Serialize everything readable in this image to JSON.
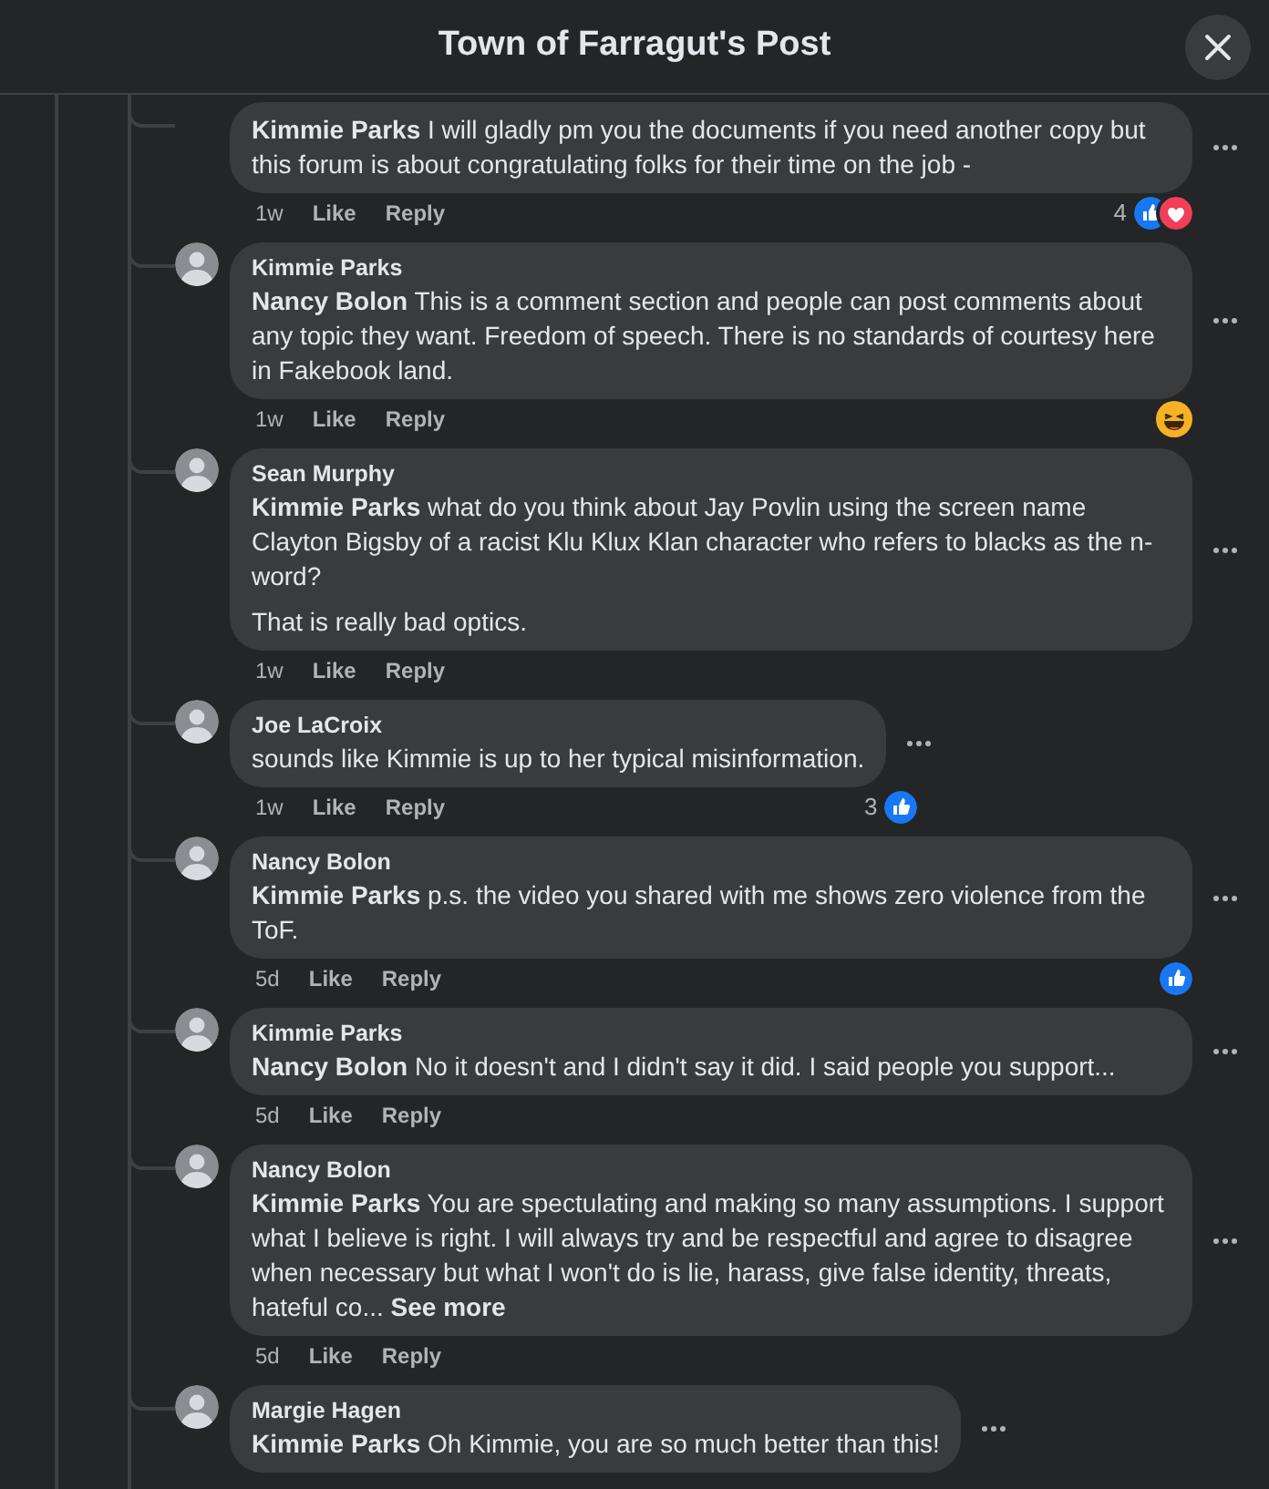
{
  "dialog": {
    "title": "Town of Farragut's Post"
  },
  "comments": [
    {
      "paragraphs": [
        "**Kimmie Parks** I will gladly pm you the documents if you need another copy but this forum is about congratulating folks for their time on the job -"
      ],
      "time": "1w",
      "like": "Like",
      "reply": "Reply",
      "reaction_count": "4",
      "reactions": [
        {
          "kind": "like"
        },
        {
          "kind": "love"
        }
      ]
    },
    {
      "author": "Kimmie Parks",
      "paragraphs": [
        "**Nancy Bolon** This is a comment section and people can post comments about any topic they want. Freedom of speech. There is no standards of courtesy here in Fakebook land."
      ],
      "time": "1w",
      "like": "Like",
      "reply": "Reply",
      "reactions": [
        {
          "kind": "haha"
        }
      ]
    },
    {
      "author": "Sean Murphy",
      "paragraphs": [
        "**Kimmie Parks** what do you think about Jay Povlin using the screen name Clayton Bigsby of a racist Klu Klux Klan character who refers to blacks as the n-word?",
        "That is really bad optics."
      ],
      "time": "1w",
      "like": "Like",
      "reply": "Reply"
    },
    {
      "author": "Joe LaCroix",
      "paragraphs": [
        "sounds like Kimmie is up to her typical misinformation."
      ],
      "time": "1w",
      "like": "Like",
      "reply": "Reply",
      "reaction_count": "3",
      "reactions": [
        {
          "kind": "like"
        }
      ]
    },
    {
      "author": "Nancy Bolon",
      "paragraphs": [
        "**Kimmie Parks** p.s. the video you shared with me shows zero violence from the ToF."
      ],
      "time": "5d",
      "like": "Like",
      "reply": "Reply",
      "reactions": [
        {
          "kind": "like"
        }
      ]
    },
    {
      "author": "Kimmie Parks",
      "paragraphs": [
        "**Nancy Bolon** No it doesn't and I didn't say it did. I said people you support..."
      ],
      "time": "5d",
      "like": "Like",
      "reply": "Reply"
    },
    {
      "author": "Nancy Bolon",
      "paragraphs": [
        "**Kimmie Parks** You are spectulating and making so many assumptions. I support what I believe is right. I will always try and be respectful and agree to disagree when necessary but what I won't do is lie, harass, give false identity, threats, hateful co..."
      ],
      "see_more": "See more",
      "time": "5d",
      "like": "Like",
      "reply": "Reply"
    },
    {
      "author": "Margie Hagen",
      "paragraphs": [
        "**Kimmie Parks** Oh Kimmie, you are so much better than this!"
      ]
    }
  ]
}
